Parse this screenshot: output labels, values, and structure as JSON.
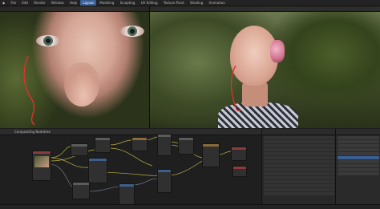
{
  "menubar": {
    "items": [
      "File",
      "Edit",
      "Render",
      "Window",
      "Help"
    ],
    "active_workspace": "Layout",
    "workspaces": [
      "Modeling",
      "Sculpting",
      "UV Editing",
      "Texture Paint",
      "Shading",
      "Animation",
      "Rendering",
      "Compositing",
      "Scripting"
    ]
  },
  "node_editor": {
    "header_label": "Compositing Nodetree"
  },
  "colors": {
    "accent": "#3a5f96",
    "annotation_stroke": "#e3302a",
    "link_yellow": "#c7c14a"
  }
}
